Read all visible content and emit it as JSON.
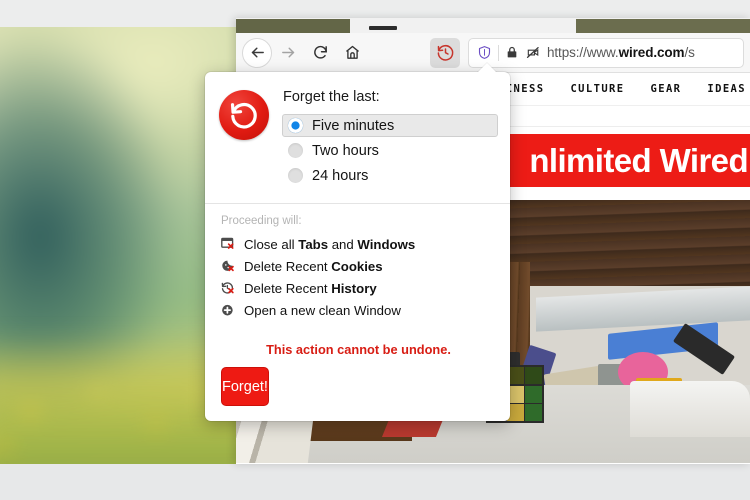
{
  "browser": {
    "nav": {
      "back_label": "Back",
      "forward_label": "Forward",
      "reload_label": "Reload",
      "home_label": "Home",
      "forget_label": "Forget"
    },
    "urlbar": {
      "url_prefix": "https://www.",
      "url_host": "wired.com",
      "url_suffix": "/s",
      "shield_label": "Tracking Protection",
      "lock_label": "Secure connection",
      "permission_label": "Blocked permission"
    }
  },
  "page": {
    "nav_items": [
      "USINESS",
      "CULTURE",
      "GEAR",
      "IDEAS"
    ],
    "hero_text": "nlimited Wired"
  },
  "popup": {
    "title": "Forget the last:",
    "logo_icon": "forget-undo-icon",
    "durations": [
      {
        "label": "Five minutes",
        "selected": true
      },
      {
        "label": "Two hours",
        "selected": false
      },
      {
        "label": "24 hours",
        "selected": false
      }
    ],
    "proceeding_heading": "Proceeding will:",
    "actions": [
      {
        "icon": "window-close-icon",
        "prefix": "Close all ",
        "bold1": "Tabs",
        "mid": " and ",
        "bold2": "Windows"
      },
      {
        "icon": "cookie-delete-icon",
        "prefix": "Delete Recent ",
        "bold1": "Cookies",
        "mid": "",
        "bold2": ""
      },
      {
        "icon": "history-delete-icon",
        "prefix": "Delete Recent ",
        "bold1": "History",
        "mid": "",
        "bold2": ""
      },
      {
        "icon": "plus-circle-icon",
        "prefix": "Open a new clean Window",
        "bold1": "",
        "mid": "",
        "bold2": ""
      }
    ],
    "warning": "This action cannot be undone.",
    "confirm_label": "Forget!"
  },
  "colors": {
    "accent_red": "#ee1a13",
    "radio_blue": "#1185e8",
    "warning_red": "#d81d14",
    "banner_red": "#ed1c16"
  }
}
